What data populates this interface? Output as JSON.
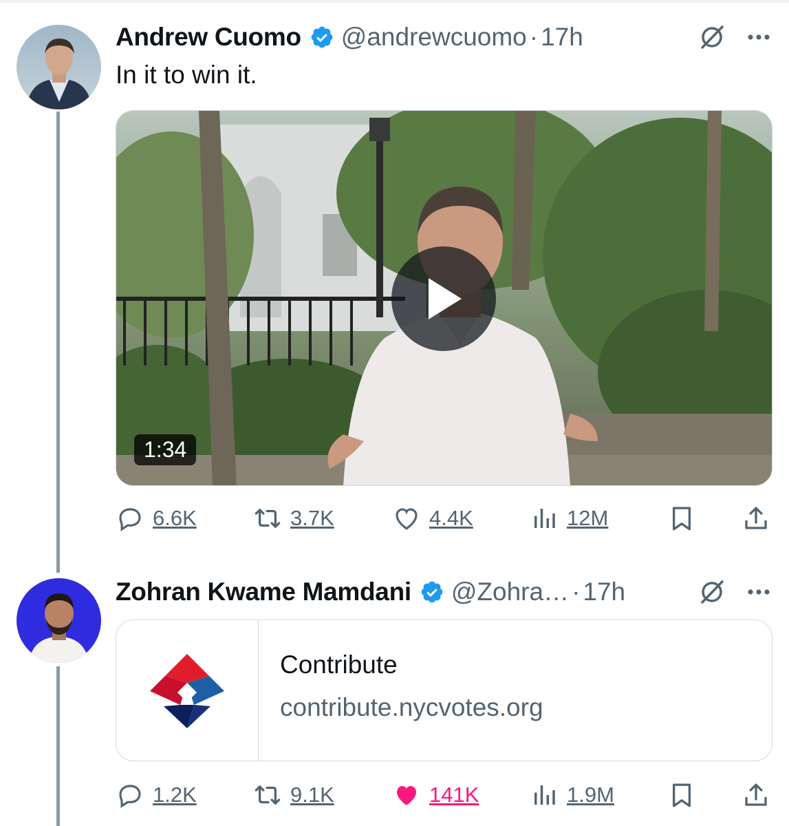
{
  "tweets": [
    {
      "author_name": "Andrew Cuomo",
      "handle": "@andrewcuomo",
      "time": "17h",
      "text": "In it to win it.",
      "video_duration": "1:34",
      "stats": {
        "replies": "6.6K",
        "reposts": "3.7K",
        "likes": "4.4K",
        "views": "12M"
      },
      "liked": false
    },
    {
      "author_name": "Zohran Kwame Mamdani",
      "handle": "@Zohra…",
      "time": "17h",
      "card": {
        "title": "Contribute",
        "url": "contribute.nycvotes.org"
      },
      "stats": {
        "replies": "1.2K",
        "reposts": "9.1K",
        "likes": "141K",
        "views": "1.9M"
      },
      "liked": true
    }
  ],
  "colors": {
    "verified": "#1d9bf0",
    "text_secondary": "#536471",
    "like_active": "#f91880",
    "thread_line": "#8b98a5",
    "avatar2_bg": "#2f2ce0"
  },
  "icons": [
    "verified-badge-icon",
    "grok-icon",
    "more-icon",
    "reply-icon",
    "repost-icon",
    "like-icon",
    "views-icon",
    "bookmark-icon",
    "share-icon",
    "play-icon",
    "nycvotes-logo"
  ]
}
